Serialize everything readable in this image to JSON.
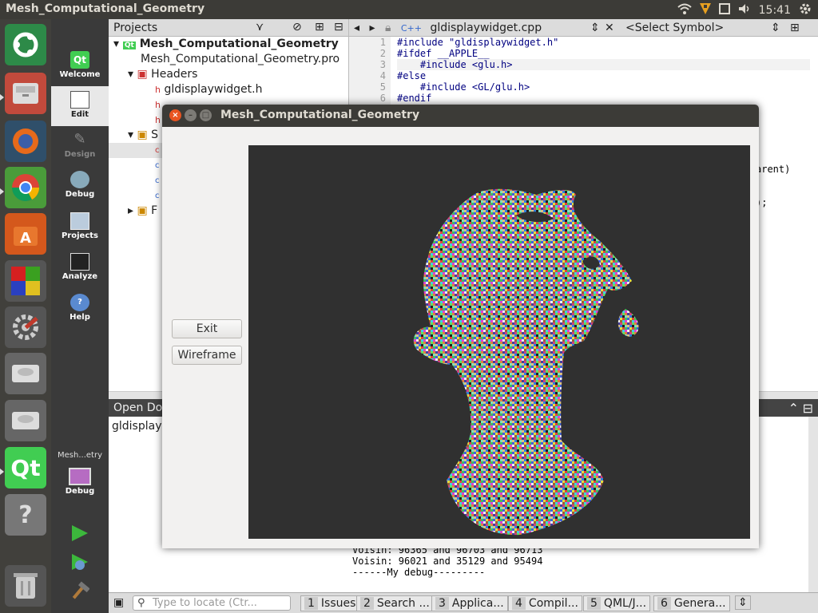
{
  "topbar": {
    "title": "Mesh_Computational_Geometry",
    "time": "15:41"
  },
  "launcher": {
    "items": [
      "ubuntu-dash",
      "files",
      "firefox",
      "chrome",
      "software-center",
      "libreoffice-calc",
      "system-settings",
      "disk",
      "disk",
      "qt-creator",
      "help",
      "trash"
    ]
  },
  "modes": [
    {
      "label": "Welcome"
    },
    {
      "label": "Edit"
    },
    {
      "label": "Design"
    },
    {
      "label": "Debug"
    },
    {
      "label": "Projects"
    },
    {
      "label": "Analyze"
    },
    {
      "label": "Help"
    }
  ],
  "kit": {
    "name": "Mesh...etry",
    "mode": "Debug"
  },
  "projects": {
    "header": "Projects",
    "tree": [
      {
        "text": "Mesh_Computational_Geometry",
        "indent": 0
      },
      {
        "text": "Mesh_Computational_Geometry.pro",
        "indent": 1
      },
      {
        "text": "Headers",
        "indent": 1
      },
      {
        "text": "gldisplaywidget.h",
        "indent": 2
      },
      {
        "text": "h",
        "indent": 2
      },
      {
        "text": "h",
        "indent": 2
      },
      {
        "text": "S",
        "indent": 1
      },
      {
        "text": "c",
        "indent": 2
      },
      {
        "text": "c",
        "indent": 2
      },
      {
        "text": "c",
        "indent": 2
      },
      {
        "text": "c",
        "indent": 2
      },
      {
        "text": "F",
        "indent": 1
      }
    ]
  },
  "editor": {
    "file": "gldisplaywidget.cpp",
    "symbol": "<Select Symbol>",
    "lines": [
      "#include \"gldisplaywidget.h\"",
      "#ifdef __APPLE__",
      "    #include <glu.h>",
      "#else",
      "    #include <GL/glu.h>",
      "#endif"
    ],
    "line_numbers": [
      "1",
      "2",
      "3",
      "4",
      "5",
      "6"
    ],
    "frag1": "arent)",
    "frag2": ");"
  },
  "outpane": {
    "header": "Open Do",
    "sub": "gldisplayw",
    "log": [
      "Voisin: 96365 and 96703 and 96713",
      "Voisin: 96021 and 35129 and 95494",
      "------My debug---------"
    ]
  },
  "bottombar": {
    "locate_placeholder": "Type to locate (Ctr...",
    "tabs": [
      {
        "n": "1",
        "label": "Issues"
      },
      {
        "n": "2",
        "label": "Search ..."
      },
      {
        "n": "3",
        "label": "Applica..."
      },
      {
        "n": "4",
        "label": "Compil..."
      },
      {
        "n": "5",
        "label": "QML/J..."
      },
      {
        "n": "6",
        "label": "Genera..."
      }
    ]
  },
  "dialog": {
    "title": "Mesh_Computational_Geometry",
    "exit_label": "Exit",
    "wireframe_label": "Wireframe"
  }
}
